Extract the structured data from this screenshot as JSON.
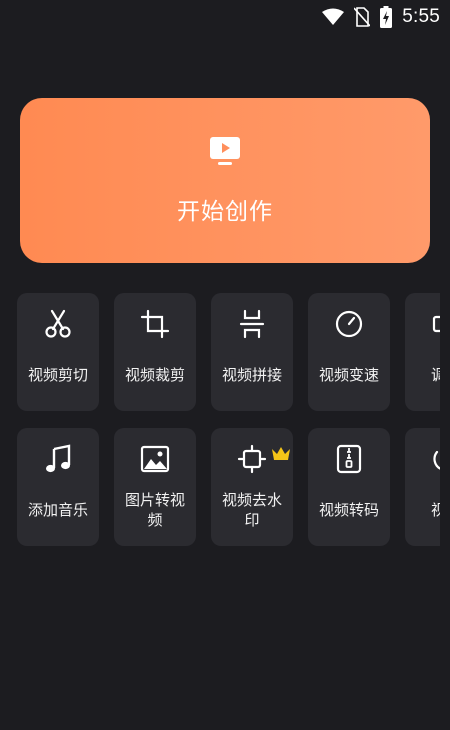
{
  "status_bar": {
    "time": "5:55",
    "icons": [
      "wifi-icon",
      "no-sim-icon",
      "battery-charging-icon"
    ]
  },
  "hero": {
    "icon": "video-play-icon",
    "title": "开始创作"
  },
  "tools_row_1": [
    {
      "label": "视频剪切",
      "icon": "scissors-icon"
    },
    {
      "label": "视频裁剪",
      "icon": "crop-icon"
    },
    {
      "label": "视频拼接",
      "icon": "join-icon"
    },
    {
      "label": "视频变速",
      "icon": "speed-dial-icon"
    },
    {
      "label": "调整",
      "icon": "adjust-icon"
    }
  ],
  "tools_row_2": [
    {
      "label": "添加音乐",
      "icon": "music-note-icon"
    },
    {
      "label": "图片转视频",
      "icon": "image-icon"
    },
    {
      "label": "视频去水印",
      "icon": "watermark-remove-icon",
      "badge": "crown-icon"
    },
    {
      "label": "视频转码",
      "icon": "zip-file-icon"
    },
    {
      "label": "视频",
      "icon": "rotate-icon"
    }
  ],
  "colors": {
    "background": "#1c1c20",
    "tile": "#2b2b30",
    "hero_start": "#ff8a52",
    "hero_end": "#ff9a6a",
    "crown": "#f5c518"
  }
}
